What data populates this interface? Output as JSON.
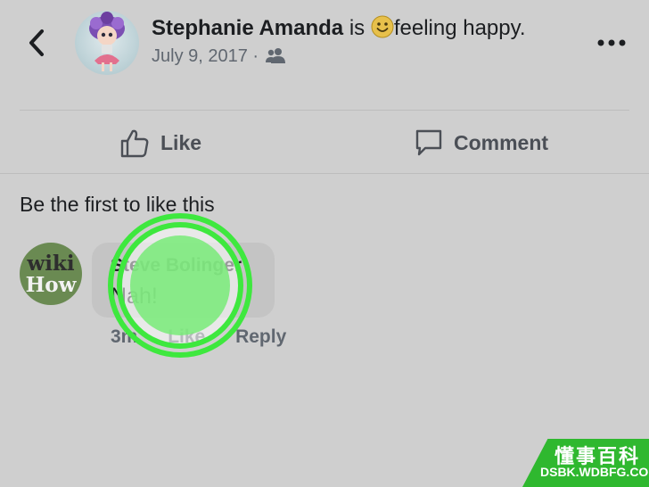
{
  "post": {
    "author": "Stephanie Amanda",
    "status_prefix": "is",
    "feeling": "feeling happy.",
    "date": "July 9, 2017",
    "separator": "·",
    "audience_icon": "friends-icon"
  },
  "actions": {
    "like_label": "Like",
    "comment_label": "Comment"
  },
  "reactions": {
    "summary": "Be the first to like this"
  },
  "comment": {
    "author": "Steve Bolinger",
    "text": "Nah!",
    "time": "3m",
    "like_label": "Like",
    "reply_label": "Reply",
    "avatar_line1": "wiki",
    "avatar_line2": "How"
  },
  "watermark": {
    "line1": "懂事百科",
    "line2": "DSBK.WDBFG.COM"
  },
  "colors": {
    "background": "#cfcfcf",
    "tap_green": "#3ee83e",
    "watermark_green": "#2fb82f"
  }
}
